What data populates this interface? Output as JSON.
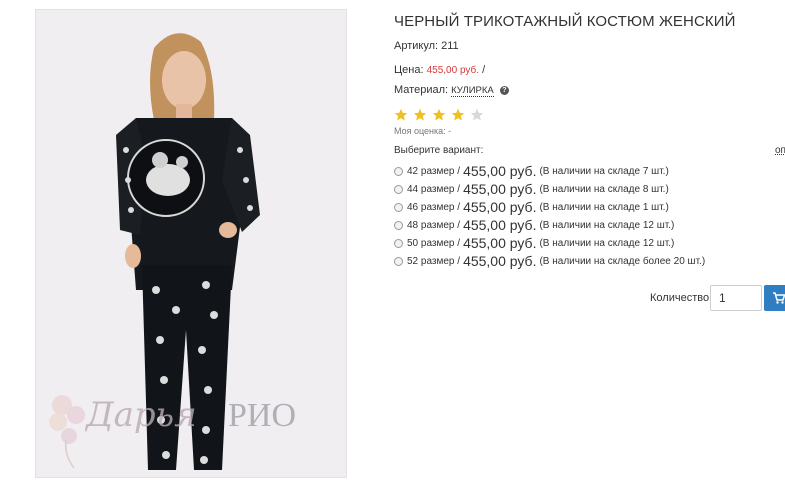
{
  "product": {
    "title": "ЧЕРНЫЙ ТРИКОТАЖНЫЙ КОСТЮМ ЖЕНСКИЙ",
    "article_label": "Артикул:",
    "article_value": "211",
    "price_label": "Цена:",
    "price_value": "455,00 руб.",
    "price_separator": "/",
    "material_label": "Материал:",
    "material_value": "КУЛИРКА",
    "rating": {
      "stars_filled": 4,
      "stars_total": 5,
      "filled_color": "#f0c01e",
      "empty_color": "#d8d8d8"
    },
    "my_rating_label": "Моя оценка: -",
    "choose_variant_label": "Выберите вариант:",
    "more_link": "оп",
    "image_watermark": {
      "script": "Дарья",
      "brand": "РИО"
    }
  },
  "variants": [
    {
      "size": "42 размер",
      "sep": "/",
      "price": "455,00 руб.",
      "stock": "(В наличии на складе 7 шт.)"
    },
    {
      "size": "44 размер",
      "sep": "/",
      "price": "455,00 руб.",
      "stock": "(В наличии на складе 8 шт.)"
    },
    {
      "size": "46 размер",
      "sep": "/",
      "price": "455,00 руб.",
      "stock": "(В наличии на складе 1 шт.)"
    },
    {
      "size": "48 размер",
      "sep": "/",
      "price": "455,00 руб.",
      "stock": "(В наличии на складе 12 шт.)"
    },
    {
      "size": "50 размер",
      "sep": "/",
      "price": "455,00 руб.",
      "stock": "(В наличии на складе 12 шт.)"
    },
    {
      "size": "52 размер",
      "sep": "/",
      "price": "455,00 руб.",
      "stock": "(В наличии на складе более 20 шт.)"
    }
  ],
  "cart": {
    "quantity_label": "Количество",
    "quantity_value": "1",
    "button_icon": "cart-icon",
    "button_color": "#2e7ec1"
  },
  "icons": {
    "material_help": "question-circle-icon",
    "star": "star-icon"
  }
}
